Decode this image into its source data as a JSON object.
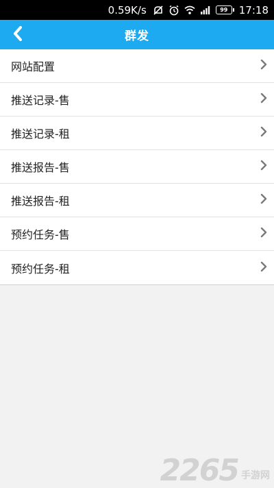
{
  "status_bar": {
    "speed": "0.59K/s",
    "battery": "99",
    "time": "17:18",
    "icons": [
      "notification-muted-icon",
      "alarm-icon",
      "wifi-icon",
      "signal-icon",
      "battery-icon"
    ]
  },
  "header": {
    "title": "群发",
    "back_icon": "chevron-left-icon",
    "background_color": "#1eaaf1"
  },
  "menu": {
    "items": [
      {
        "label": "网站配置"
      },
      {
        "label": "推送记录-售"
      },
      {
        "label": "推送记录-租"
      },
      {
        "label": "推送报告-售"
      },
      {
        "label": "推送报告-租"
      },
      {
        "label": "预约任务-售"
      },
      {
        "label": "预约任务-租"
      }
    ],
    "arrow_icon": "chevron-right-icon"
  },
  "watermark": {
    "number": "2265",
    "text": "手游网"
  }
}
